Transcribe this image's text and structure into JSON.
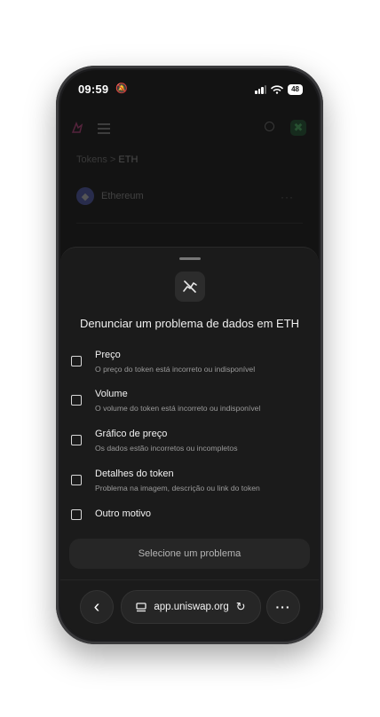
{
  "status_bar": {
    "time": "09:59",
    "battery": "48"
  },
  "background": {
    "breadcrumb_parent": "Tokens",
    "breadcrumb_separator": ">",
    "breadcrumb_current": "ETH",
    "token_name": "Ethereum",
    "more_label": "···"
  },
  "sheet": {
    "title": "Denunciar um problema de dados em ETH",
    "options": [
      {
        "title": "Preço",
        "description": "O preço do token está incorreto ou indisponível"
      },
      {
        "title": "Volume",
        "description": "O volume do token está incorreto ou indisponível"
      },
      {
        "title": "Gráfico de preço",
        "description": "Os dados estão incorretos ou incompletos"
      },
      {
        "title": "Detalhes do token",
        "description": "Problema na imagem, descrição ou link do token"
      },
      {
        "title": "Outro motivo",
        "description": ""
      }
    ],
    "submit_label": "Selecione um problema"
  },
  "browser": {
    "back_icon": "‹",
    "url": "app.uniswap.org",
    "reload_icon": "↻",
    "menu_icon": "···"
  }
}
